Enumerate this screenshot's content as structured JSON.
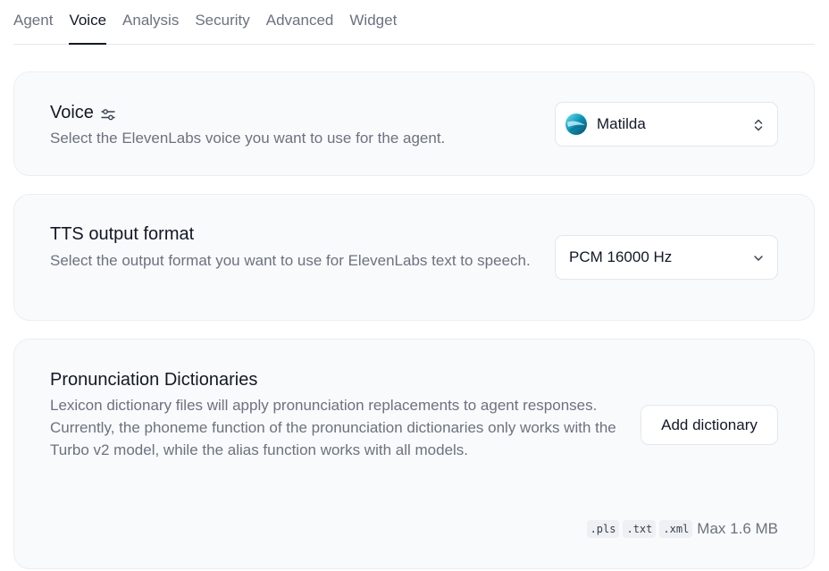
{
  "tabs": [
    {
      "label": "Agent",
      "active": false
    },
    {
      "label": "Voice",
      "active": true
    },
    {
      "label": "Analysis",
      "active": false
    },
    {
      "label": "Security",
      "active": false
    },
    {
      "label": "Advanced",
      "active": false
    },
    {
      "label": "Widget",
      "active": false
    }
  ],
  "voice": {
    "title": "Voice",
    "title_icon": "sliders-icon",
    "description": "Select the ElevenLabs voice you want to use for the agent.",
    "selected_voice": "Matilda",
    "select_icon": "chevron-up-down-icon"
  },
  "tts": {
    "title": "TTS output format",
    "description": "Select the output format you want to use for ElevenLabs text to speech.",
    "selected_format": "PCM 16000 Hz",
    "select_icon": "chevron-down-icon"
  },
  "dictionaries": {
    "title": "Pronunciation Dictionaries",
    "description": "Lexicon dictionary files will apply pronunciation replacements to agent responses. Currently, the phoneme function of the pronunciation dictionaries only works with the Turbo v2 model, while the alias function works with all models.",
    "add_button": "Add dictionary",
    "file_types": [
      ".pls",
      ".txt",
      ".xml"
    ],
    "max_size": "Max 1.6 MB"
  },
  "colors": {
    "card_background": "#f9fafb",
    "text_primary": "#111827",
    "text_secondary": "#6b7280",
    "border": "#e5e7eb"
  }
}
